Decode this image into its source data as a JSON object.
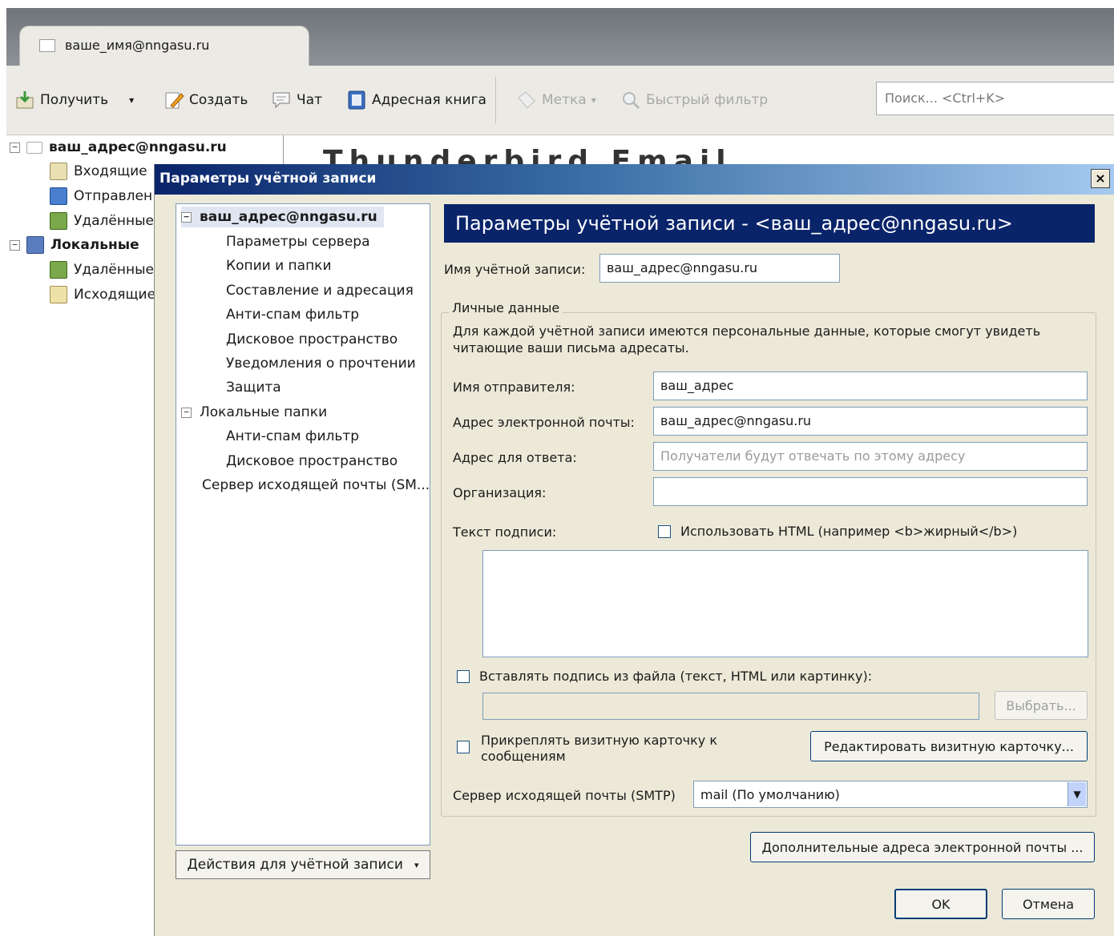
{
  "window": {
    "tab_title": "ваше_имя@nngasu.ru"
  },
  "toolbar": {
    "get_mail": "Получить",
    "write": "Создать",
    "chat": "Чат",
    "address_book": "Адресная книга",
    "tag": "Метка",
    "quick_filter": "Быстрый фильтр",
    "search_placeholder": "Поиск... <Ctrl+K>"
  },
  "folders": {
    "account": "ваш_адрес@nngasu.ru",
    "inbox": "Входящие",
    "sent": "Отправлен",
    "trash": "Удалённые",
    "local": "Локальные",
    "local_trash": "Удалённые",
    "local_outbox": "Исходящие"
  },
  "main": {
    "partial_heading": "Thunderbird   Email"
  },
  "dialog": {
    "title": "Параметры учётной записи",
    "close_symbol": "×",
    "tree": [
      {
        "label": "ваш_адрес@nngasu.ru",
        "level": 0,
        "bold": true,
        "expanded": true
      },
      {
        "label": "Параметры сервера",
        "level": 1
      },
      {
        "label": "Копии и папки",
        "level": 1
      },
      {
        "label": "Составление и адресация",
        "level": 1
      },
      {
        "label": "Анти-спам фильтр",
        "level": 1
      },
      {
        "label": "Дисковое пространство",
        "level": 1
      },
      {
        "label": "Уведомления о прочтении",
        "level": 1
      },
      {
        "label": "Защита",
        "level": 1
      },
      {
        "label": "Локальные папки",
        "level": 0,
        "expanded": true
      },
      {
        "label": "Анти-спам фильтр",
        "level": 1
      },
      {
        "label": "Дисковое пространство",
        "level": 1
      },
      {
        "label": "Сервер исходящей почты (SM...",
        "level": 0
      }
    ],
    "account_actions": "Действия для учётной записи",
    "header": "Параметры учётной записи - <ваш_адрес@nngasu.ru>",
    "account_name_label": "Имя учётной записи:",
    "account_name_value": "ваш_адрес@nngasu.ru",
    "identity_group": "Личные данные",
    "identity_desc": "Для каждой учётной записи имеются персональные данные, которые смогут увидеть читающие ваши письма адресаты.",
    "sender_name_label": "Имя отправителя:",
    "sender_name_value": "ваш_адрес",
    "email_label": "Адрес электронной почты:",
    "email_value": "ваш_адрес@nngasu.ru",
    "reply_to_label": "Адрес для ответа:",
    "reply_to_placeholder": "Получатели будут отвечать по этому адресу",
    "organization_label": "Организация:",
    "organization_value": "",
    "signature_label": "Текст подписи:",
    "use_html_label": "Использовать HTML (например <b>жирный</b>)",
    "use_html_checked": false,
    "attach_sig_label": "Вставлять подпись из файла (текст, HTML или картинку):",
    "attach_sig_checked": false,
    "choose_button": "Выбрать...",
    "attach_vcard_label": "Прикреплять визитную карточку к сообщениям",
    "attach_vcard_checked": false,
    "edit_vcard_button": "Редактировать визитную карточку...",
    "smtp_label": "Сервер исходящей почты (SMTP)",
    "smtp_value": "mail (По умолчанию)",
    "additional_addresses_button": "Дополнительные адреса электронной почты ...",
    "ok_button": "OK",
    "cancel_button": "Отмена"
  }
}
